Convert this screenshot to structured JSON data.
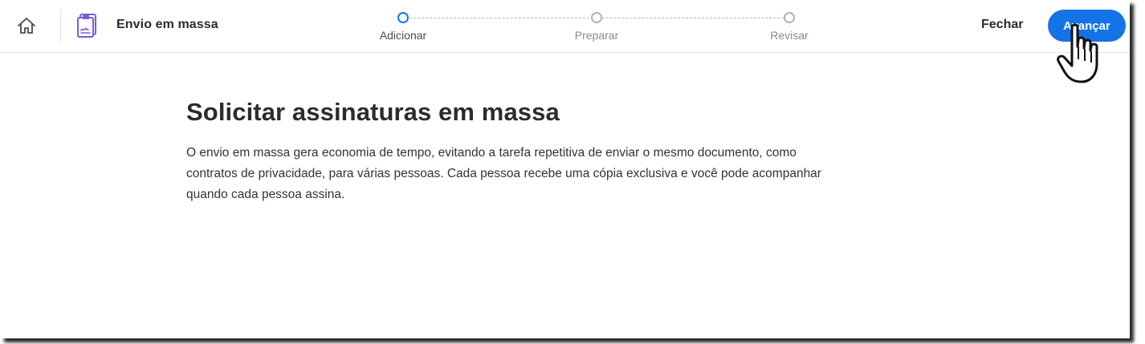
{
  "header": {
    "title": "Envio em massa",
    "close_label": "Fechar",
    "next_label": "Avançar"
  },
  "stepper": {
    "steps": [
      {
        "label": "Adicionar",
        "active": true
      },
      {
        "label": "Preparar",
        "active": false
      },
      {
        "label": "Revisar",
        "active": false
      }
    ]
  },
  "main": {
    "heading": "Solicitar assinaturas em massa",
    "description": "O envio em massa gera economia de tempo, evitando a tarefa repetitiva de enviar o mesmo documento, como contratos de privacidade, para várias pessoas. Cada pessoa recebe uma cópia exclusiva e você pode acompanhar quando cada pessoa assina."
  },
  "colors": {
    "accent": "#1473e6",
    "icon_purple": "#7b5cd6"
  },
  "icons": [
    "home-icon",
    "bulk-send-document-icon",
    "hand-pointer-cursor-icon"
  ]
}
